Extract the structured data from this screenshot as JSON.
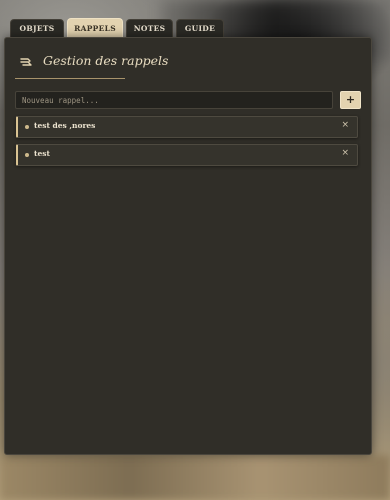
{
  "tabs": [
    {
      "label": "OBJETS",
      "active": false
    },
    {
      "label": "RAPPELS",
      "active": true
    },
    {
      "label": "NOTES",
      "active": false
    },
    {
      "label": "GUIDE",
      "active": false
    }
  ],
  "panel": {
    "title": "Gestion des rappels",
    "icon": "reminder-icon"
  },
  "new_reminder": {
    "placeholder": "Nouveau rappel...",
    "value": "",
    "add_label": "+"
  },
  "reminders": [
    {
      "text": "test des ,nores",
      "delete_label": "×"
    },
    {
      "text": "test",
      "delete_label": "×"
    }
  ],
  "colors": {
    "accent": "#e3d3b0",
    "panel_bg": "#302e28",
    "item_border": "#d9c393",
    "text": "#ece3cf"
  }
}
